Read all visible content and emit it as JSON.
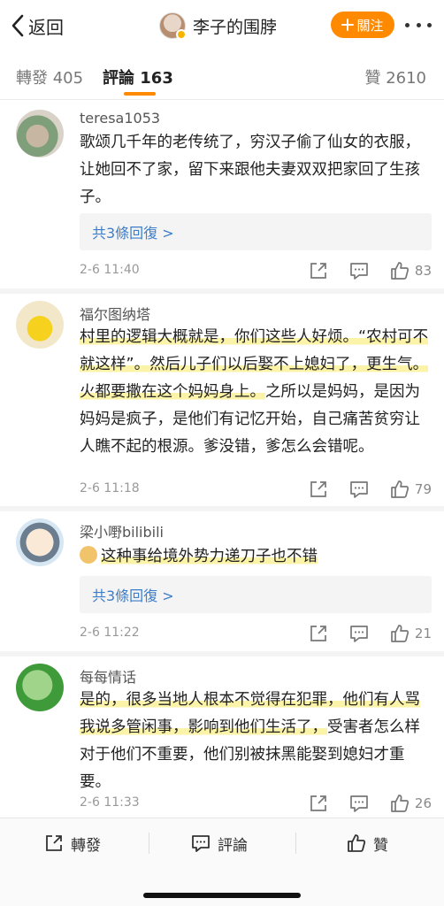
{
  "header": {
    "back_label": "返回",
    "user_name": "李子的围脖",
    "follow_label": "關注"
  },
  "tabs": {
    "repost": "轉發 405",
    "comments": "評論 163",
    "likes": "贊 2610"
  },
  "comments": [
    {
      "user": "teresa1053",
      "text": "歌颂几千年的老传统了，穷汉子偷了仙女的衣服，让她回不了家，留下来跟他夫妻双双把家回了生孩子。",
      "reply_label": "共3條回復 >",
      "time": "2-6 11:40",
      "likes": "83"
    },
    {
      "user": "福尔图纳塔",
      "text_highlight": "村里的逻辑大概就是，你们这些人好烦。“农村可不就这样”。然后儿子们以后娶不上媳妇了，更生气。火都要撒在这个妈妈身上。",
      "text_rest": "之所以是妈妈，是因为妈妈是疯子，是他们有记忆开始，自己痛苦贫穷让人瞧不起的根源。爹没错，爹怎么会错呢。",
      "time": "2-6 11:18",
      "likes": "79"
    },
    {
      "user": "梁小嘢bilibili",
      "text": "这种事给境外势力递刀子也不错",
      "reply_label": "共3條回復 >",
      "time": "2-6 11:22",
      "likes": "21"
    },
    {
      "user": "每每情话",
      "text_highlight": "是的，很多当地人根本不觉得在犯罪，他们有人骂我说多管闲事，影响到他们生活了，",
      "text_rest": "受害者怎么样对于他们不重要，他们别被抹黑能娶到媳妇才重要。",
      "time": "2-6 11:33",
      "likes": "26"
    }
  ],
  "bottom_bar": {
    "repost": "轉發",
    "comment": "評論",
    "like": "贊"
  },
  "colors": {
    "accent": "#ff8a00",
    "link": "#3d7ec9",
    "highlight": "#fbf3a8"
  }
}
